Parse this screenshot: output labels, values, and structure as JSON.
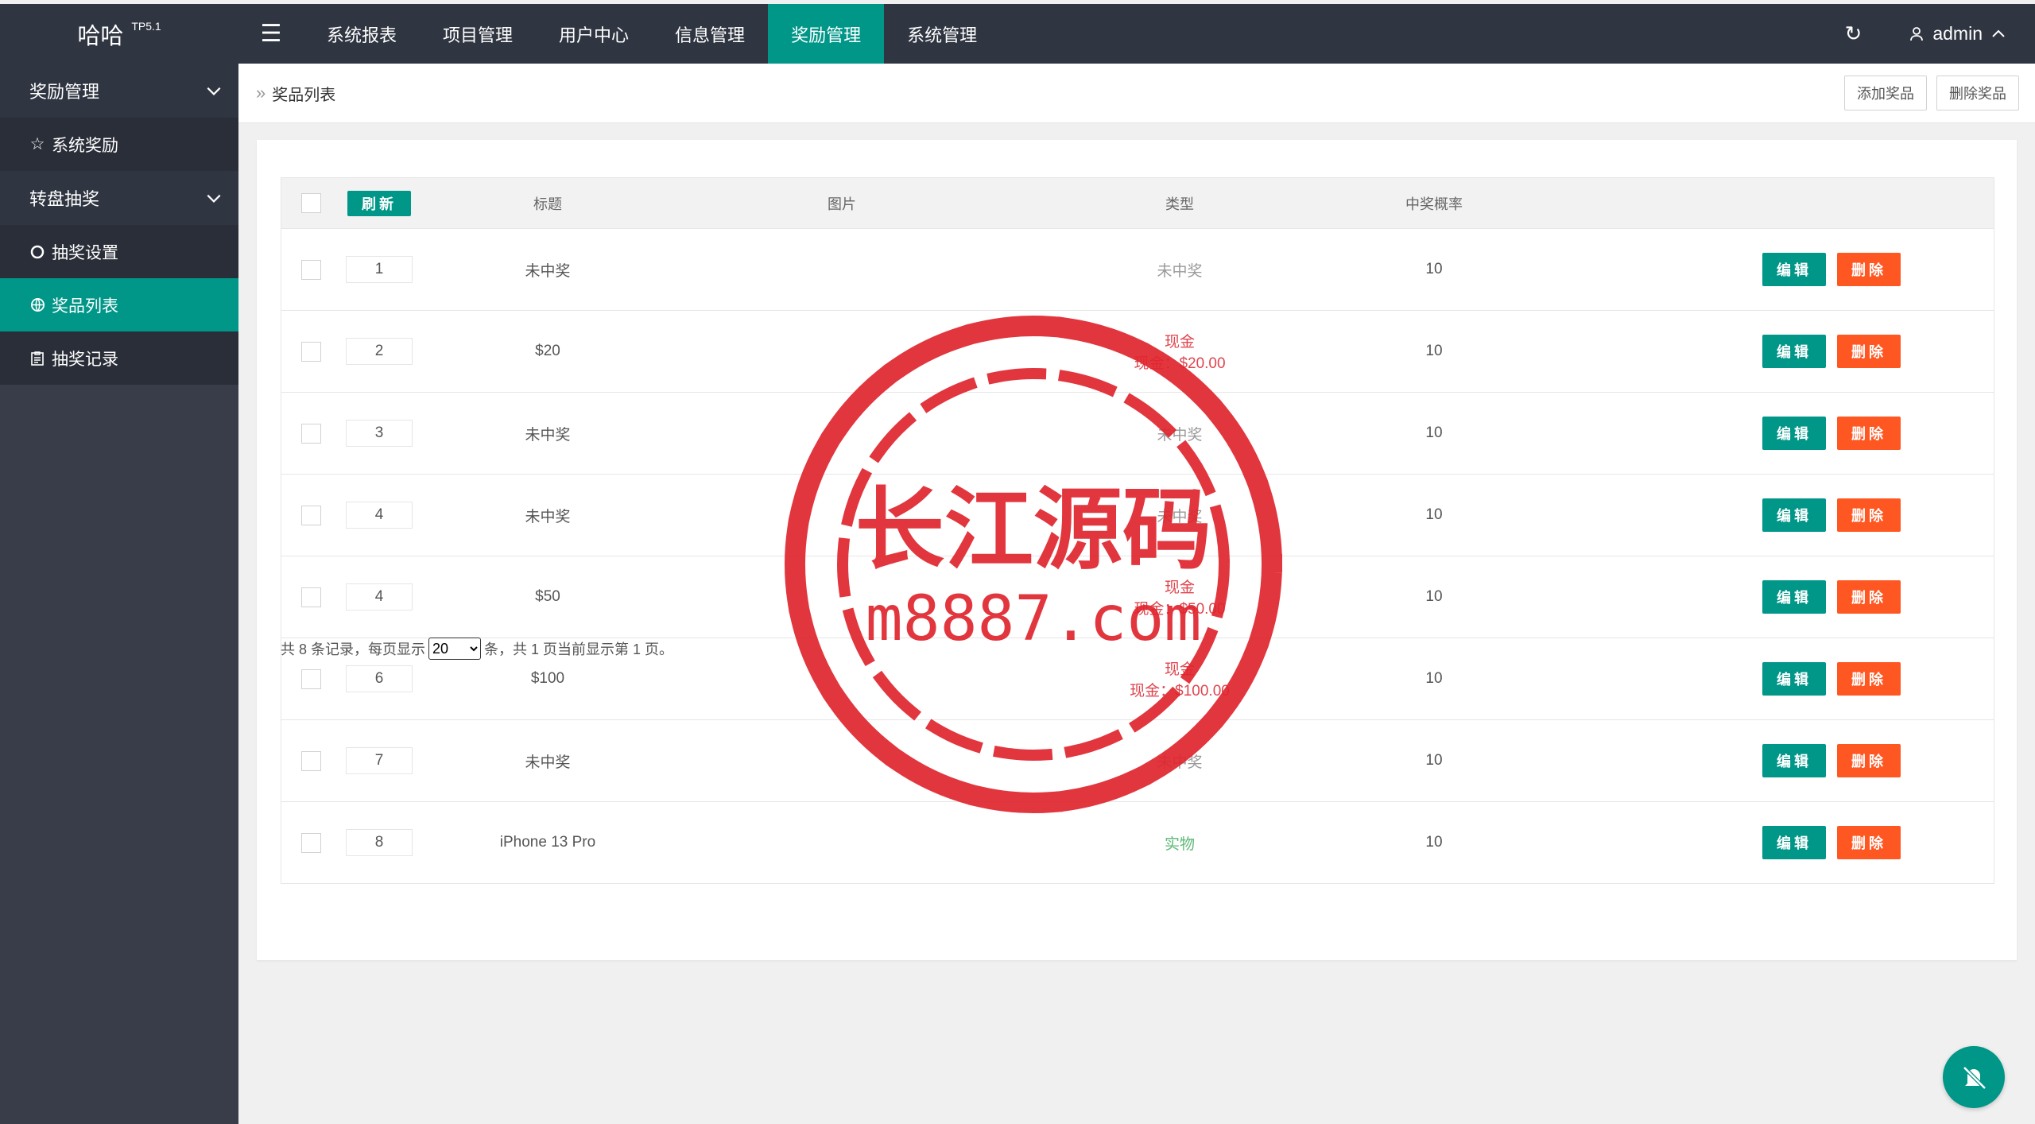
{
  "header": {
    "logo": "哈哈",
    "version": "TP5.1",
    "nav": [
      "系统报表",
      "项目管理",
      "用户中心",
      "信息管理",
      "奖励管理",
      "系统管理"
    ],
    "active_nav": 4,
    "user": "admin"
  },
  "sidebar": {
    "group1": "奖励管理",
    "item1": "系统奖励",
    "group2": "转盘抽奖",
    "item2": "抽奖设置",
    "item3": "奖品列表",
    "item4": "抽奖记录"
  },
  "breadcrumb": {
    "current": "奖品列表"
  },
  "toolbar": {
    "add": "添加奖品",
    "delete": "删除奖品"
  },
  "table": {
    "refresh": "刷新",
    "headers": {
      "title": "标题",
      "image": "图片",
      "type": "类型",
      "rate": "中奖概率"
    },
    "edit_label": "编辑",
    "delete_label": "删除",
    "rows": [
      {
        "sort": "1",
        "title": "未中奖",
        "type_line1": "未中奖",
        "type_line2": "",
        "type_kind": "none",
        "rate": "10"
      },
      {
        "sort": "2",
        "title": "$20",
        "type_line1": "现金",
        "type_line2": "现金：$20.00",
        "type_kind": "cash",
        "rate": "10"
      },
      {
        "sort": "3",
        "title": "未中奖",
        "type_line1": "未中奖",
        "type_line2": "",
        "type_kind": "none",
        "rate": "10"
      },
      {
        "sort": "4",
        "title": "未中奖",
        "type_line1": "未中奖",
        "type_line2": "",
        "type_kind": "none",
        "rate": "10"
      },
      {
        "sort": "4",
        "title": "$50",
        "type_line1": "现金",
        "type_line2": "现金：$50.00",
        "type_kind": "cash",
        "rate": "10"
      },
      {
        "sort": "6",
        "title": "$100",
        "type_line1": "现金",
        "type_line2": "现金：$100.00",
        "type_kind": "cash",
        "rate": "10"
      },
      {
        "sort": "7",
        "title": "未中奖",
        "type_line1": "未中奖",
        "type_line2": "",
        "type_kind": "none",
        "rate": "10"
      },
      {
        "sort": "8",
        "title": "iPhone 13 Pro",
        "type_line1": "实物",
        "type_line2": "",
        "type_kind": "item",
        "rate": "10"
      }
    ]
  },
  "pagination": {
    "prefix": "共 8 条记录，每页显示",
    "page_size": "20",
    "suffix": "条，共 1 页当前显示第 1 页。"
  },
  "watermark": {
    "line1": "长江源码",
    "line2": "m8887.com"
  },
  "colors": {
    "accent": "#009688",
    "danger": "#ff5722",
    "dark": "#2f3541",
    "stamp": "#e0252e"
  }
}
